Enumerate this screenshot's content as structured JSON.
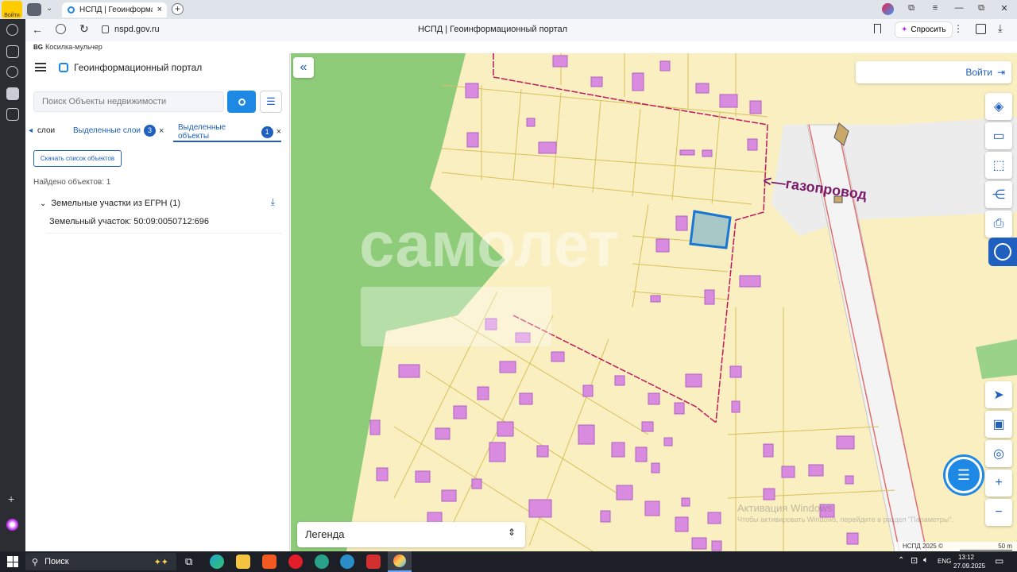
{
  "browser": {
    "yandex_label": "Войти",
    "tab_title": "НСПД | Геоинформацион",
    "url": "nspd.gov.ru",
    "page_title": "НСПД | Геоинформационный портал",
    "ask_label": "Спросить",
    "bookmark": "Косилка-мульчер"
  },
  "panel": {
    "app_title": "Геоинформационный портал",
    "search_placeholder": "Поиск Объекты недвижимости",
    "tabs": [
      {
        "label": "слои"
      },
      {
        "label": "Выделенные слои",
        "count": "3"
      },
      {
        "label": "Выделенные объекты",
        "count": "1"
      }
    ],
    "download_label": "Скачать список объектов",
    "found_label": "Найдено объектов: 1",
    "group_label": "Земельные участки из ЕГРН (1)",
    "item_label": "Земельный участок: 50:09:0050712:696"
  },
  "map": {
    "login_label": "Войти",
    "annotation": "<—газопровод",
    "legend_label": "Легенда",
    "copyright": "НСПД 2025 ©",
    "scale": "50 m",
    "watermark_1": "Активация Windows",
    "watermark_2": "Чтобы активировать Windows, перейдите в раздел \"Параметры\"."
  },
  "taskbar": {
    "search_label": "Поиск",
    "lang": "ENG",
    "time": "13:12",
    "date": "27.09.2025"
  },
  "colors": {
    "accent": "#1e5fbf",
    "map_bg": "#f9efc0",
    "forest": "#8fcc7a",
    "building": "#d98be0",
    "border_line": "#c2185b",
    "selected": "#1976d2"
  }
}
